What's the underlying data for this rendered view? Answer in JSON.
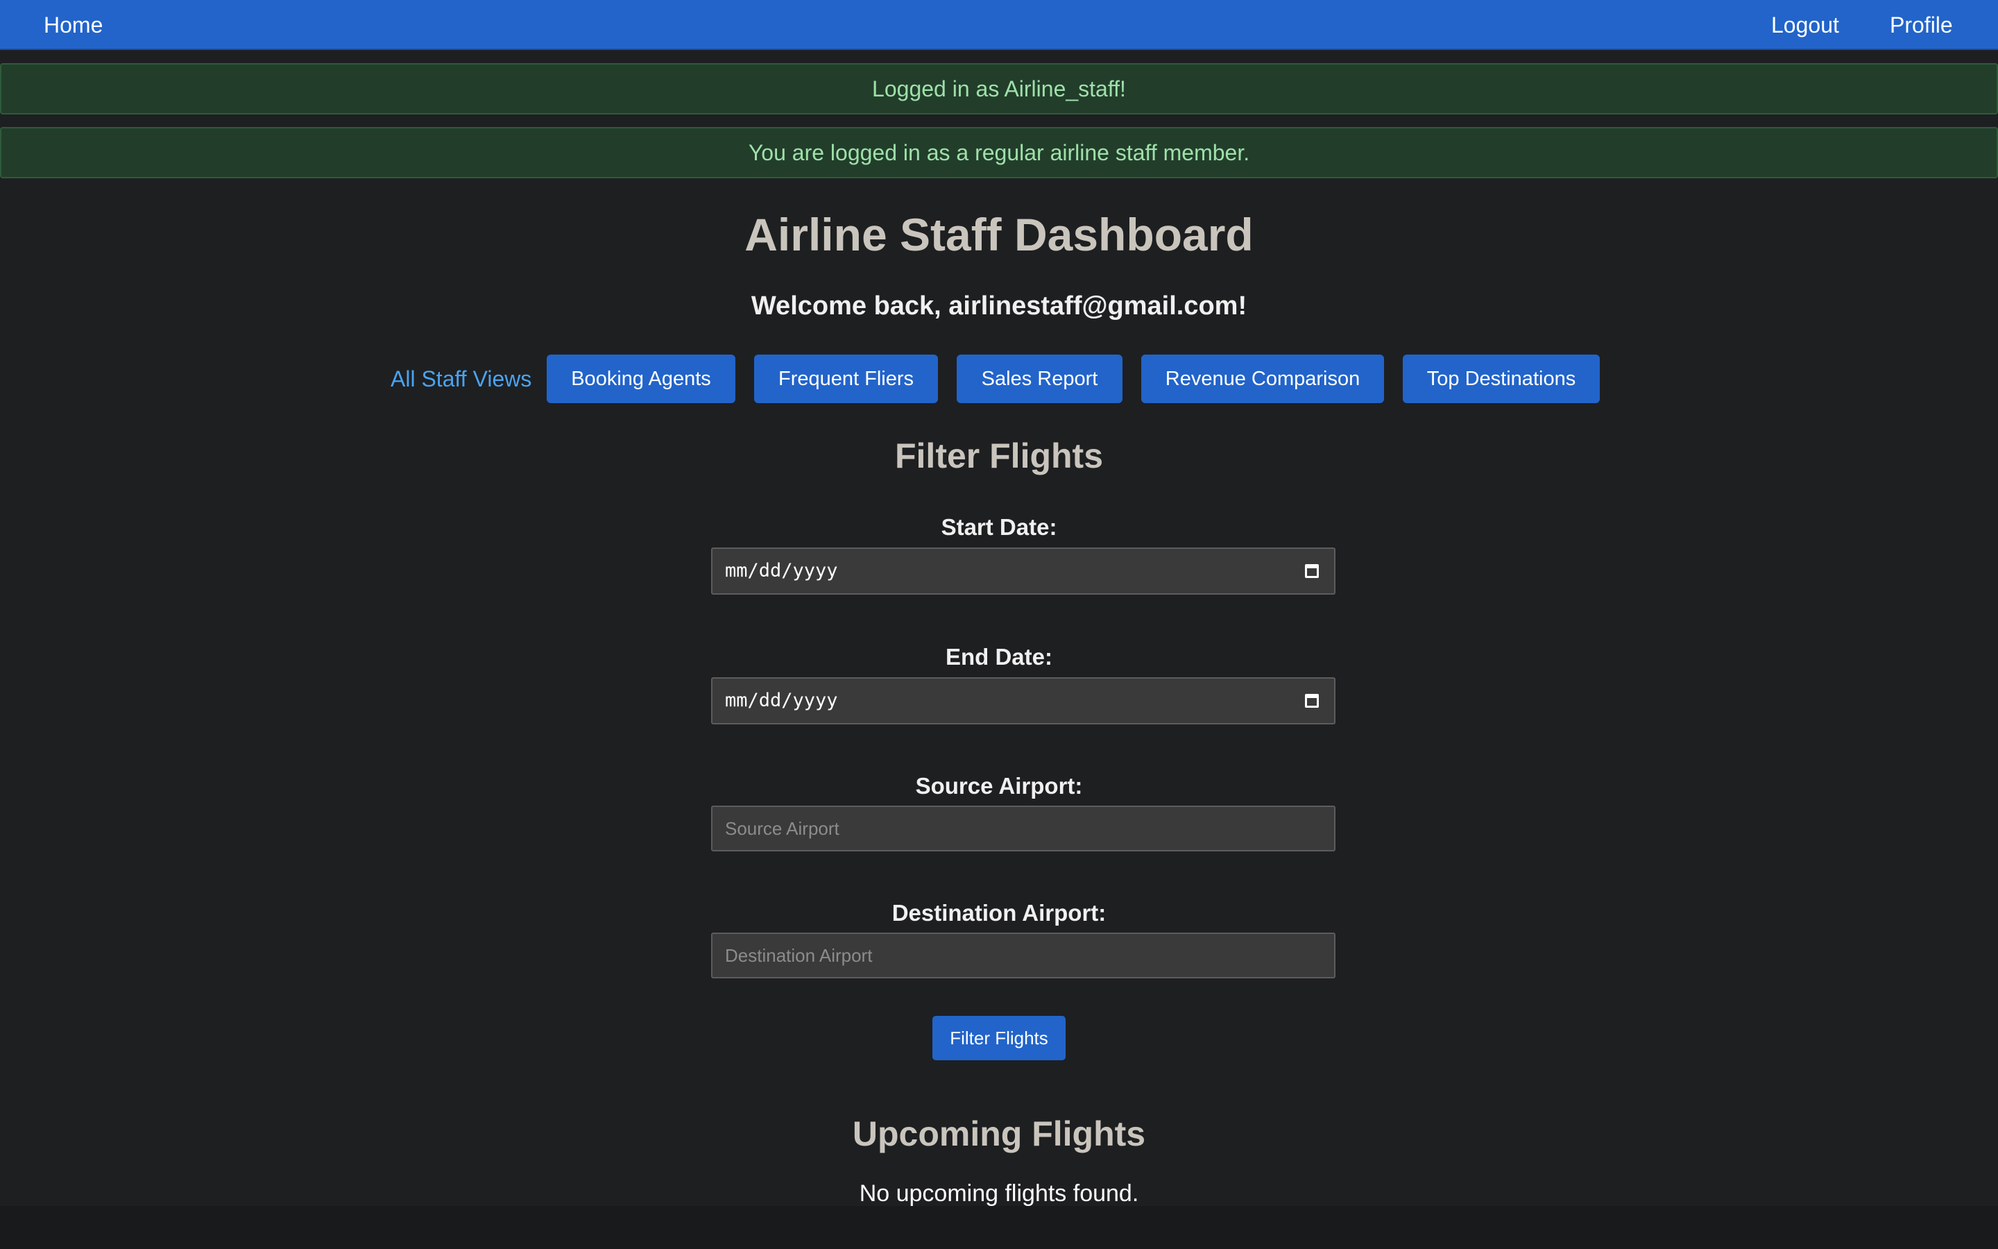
{
  "nav": {
    "home": "Home",
    "logout": "Logout",
    "profile": "Profile"
  },
  "alerts": [
    "Logged in as Airline_staff!",
    "You are logged in as a regular airline staff member."
  ],
  "page_title": "Airline Staff Dashboard",
  "welcome": "Welcome back, airlinestaff@gmail.com!",
  "staff_views": {
    "link": "All Staff Views",
    "buttons": [
      "Booking Agents",
      "Frequent Fliers",
      "Sales Report",
      "Revenue Comparison",
      "Top Destinations"
    ]
  },
  "filter": {
    "title": "Filter Flights",
    "start_date_label": "Start Date:",
    "start_date_value": "mm/dd/yyyy",
    "end_date_label": "End Date:",
    "end_date_value": "mm/dd/yyyy",
    "source_label": "Source Airport:",
    "source_placeholder": "Source Airport",
    "destination_label": "Destination Airport:",
    "destination_placeholder": "Destination Airport",
    "submit": "Filter Flights"
  },
  "upcoming": {
    "title": "Upcoming Flights",
    "empty": "No upcoming flights found."
  },
  "icons": {
    "date_picker": "calendar-icon"
  },
  "colors": {
    "primary": "#2264ca",
    "background": "#1e1f21",
    "alert_bg": "#223e2b",
    "alert_text": "#9fe0a9",
    "link": "#4aa3f0"
  }
}
